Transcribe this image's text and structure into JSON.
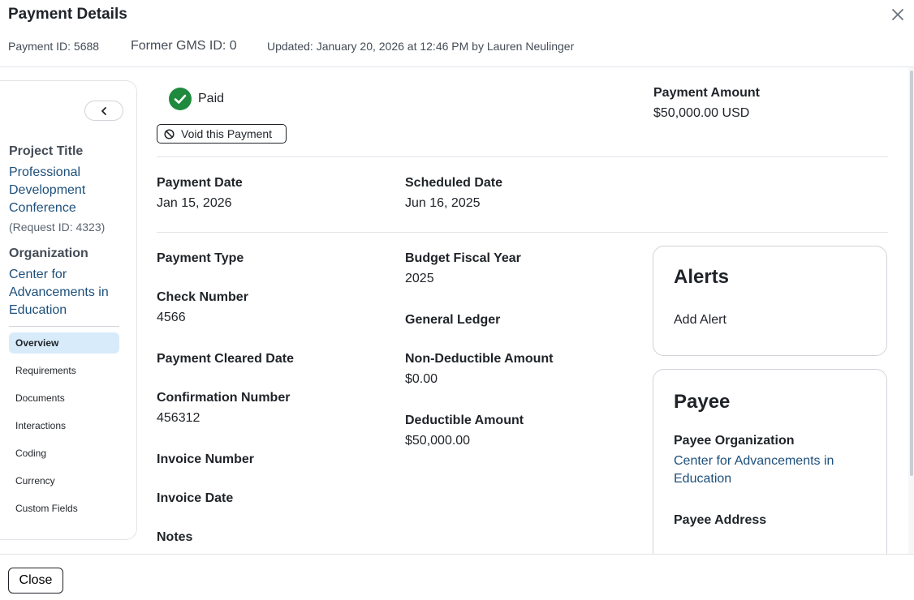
{
  "header": {
    "title": "Payment Details",
    "payment_id": "Payment ID: 5688",
    "former_gms_id": "Former GMS ID: 0",
    "updated": "Updated: January 20, 2026 at 12:46 PM by Lauren Neulinger"
  },
  "sidebar": {
    "project_title_label": "Project Title",
    "project_title_value": "Professional Development Conference",
    "request_id": "(Request ID: 4323)",
    "organization_label": "Organization",
    "organization_value": "Center for Advancements in Education",
    "nav": [
      "Overview",
      "Requirements",
      "Documents",
      "Interactions",
      "Coding",
      "Currency",
      "Custom Fields"
    ],
    "active_nav": "Overview"
  },
  "status": {
    "label": "Paid",
    "color": "#1f8a3e",
    "void_label": "Void this Payment"
  },
  "amount": {
    "label": "Payment Amount",
    "value": "$50,000.00 USD"
  },
  "dates": {
    "payment_date_label": "Payment Date",
    "payment_date_value": "Jan 15, 2026",
    "scheduled_date_label": "Scheduled Date",
    "scheduled_date_value": "Jun 16, 2025"
  },
  "fields_left": {
    "payment_type_label": "Payment Type",
    "check_number_label": "Check Number",
    "check_number_value": "4566",
    "payment_cleared_label": "Payment Cleared Date",
    "confirmation_label": "Confirmation Number",
    "confirmation_value": "456312",
    "invoice_number_label": "Invoice Number",
    "invoice_date_label": "Invoice Date",
    "notes_label": "Notes"
  },
  "fields_mid": {
    "budget_fy_label": "Budget Fiscal Year",
    "budget_fy_value": "2025",
    "general_ledger_label": "General Ledger",
    "non_deductible_label": "Non-Deductible Amount",
    "non_deductible_value": "$0.00",
    "deductible_label": "Deductible Amount",
    "deductible_value": "$50,000.00"
  },
  "alerts": {
    "title": "Alerts",
    "add_label": "Add Alert"
  },
  "payee": {
    "title": "Payee",
    "org_label": "Payee Organization",
    "org_value": "Center for Advancements in Education",
    "address_label": "Payee Address"
  },
  "footer": {
    "close_label": "Close"
  },
  "icons": {
    "close": "close-icon",
    "chevron": "chevron-left-icon",
    "check": "check-circle-icon",
    "void": "block-icon"
  }
}
